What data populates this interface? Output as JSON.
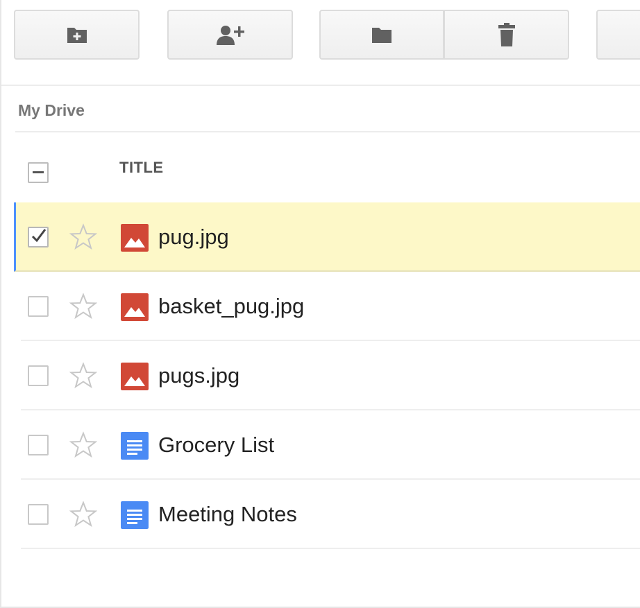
{
  "toolbar": {
    "buttons": [
      {
        "icon": "new-folder-icon"
      },
      {
        "icon": "share-icon"
      },
      {
        "icon": "move-to-folder-icon"
      },
      {
        "icon": "trash-icon"
      },
      {
        "icon": "more-icon"
      }
    ]
  },
  "breadcrumb": {
    "label": "My Drive"
  },
  "table": {
    "header": {
      "title": "TITLE"
    },
    "rows": [
      {
        "name": "pug.jpg",
        "type": "image",
        "selected": true,
        "starred": false
      },
      {
        "name": "basket_pug.jpg",
        "type": "image",
        "selected": false,
        "starred": false
      },
      {
        "name": "pugs.jpg",
        "type": "image",
        "selected": false,
        "starred": false
      },
      {
        "name": "Grocery List",
        "type": "document",
        "selected": false,
        "starred": false
      },
      {
        "name": "Meeting Notes",
        "type": "document",
        "selected": false,
        "starred": false
      }
    ]
  },
  "colors": {
    "selected_row_bg": "#fdf8c8",
    "selected_accent": "#4d90fe",
    "image_icon": "#d14836",
    "doc_icon": "#4a8af4"
  }
}
